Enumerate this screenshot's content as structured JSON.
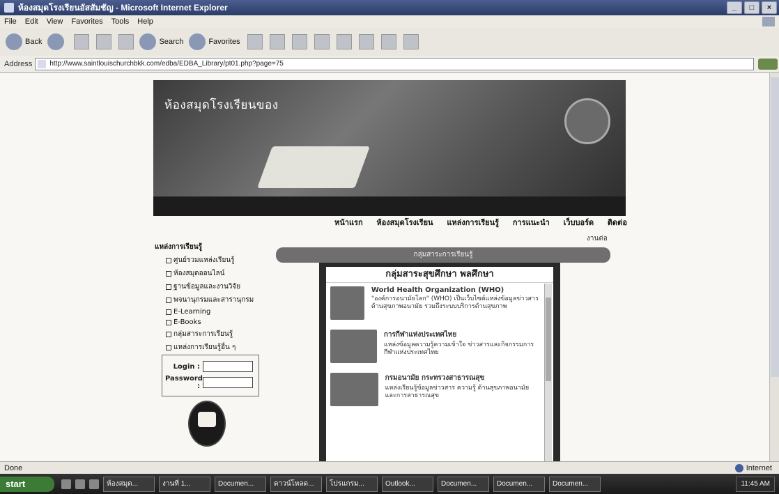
{
  "window": {
    "title": "ห้องสมุดโรงเรียนอัสสัมชัญ - Microsoft Internet Explorer"
  },
  "menu": [
    "File",
    "Edit",
    "View",
    "Favorites",
    "Tools",
    "Help"
  ],
  "toolbar": {
    "back": "Back",
    "search": "Search",
    "favorites": "Favorites"
  },
  "address": {
    "label": "Address",
    "url": "http://www.saintlouischurchbkk.com/edba/EDBA_Library/pt01.php?page=75"
  },
  "banner": {
    "site_title": "ห้องสมุดโรงเรียนของ"
  },
  "nav": [
    "หน้าแรก",
    "ห้องสมุดโรงเรียน",
    "แหล่งการเรียนรู้",
    "การแนะนำ",
    "เว็บบอร์ด",
    "ติดต่อ"
  ],
  "more_link": "งานต่อ",
  "left_menu": {
    "heading": "แหล่งการเรียนรู้",
    "items": [
      "ศูนย์รวมแหล่งเรียนรู้",
      "ห้องสมุดออนไลน์",
      "ฐานข้อมูลและงานวิจัย",
      "พจนานุกรมและสารานุกรม",
      "E-Learning",
      "E-Books",
      "กลุ่มสาระการเรียนรู้",
      "แหล่งการเรียนรู้อื่น ๆ"
    ]
  },
  "login": {
    "login_label": "Login :",
    "password_label": "Password :"
  },
  "scroll_banner": "กลุ่มสาระการเรียนรู้",
  "panel": {
    "title": "กลุ่มสาระสุขศึกษา พลศึกษา",
    "entries": [
      {
        "title": "World Health Organization (WHO)",
        "desc": "\"องค์การอนามัยโลก\" (WHO) เป็นเว็บไซต์แหล่งข้อมูลข่าวสารด้านสุขภาพอนามัย รวมถึงระบบบริการด้านสุขภาพ"
      },
      {
        "title": "การกีฬาแห่งประเทศไทย",
        "desc": "แหล่งข้อมูลความรู้ความเข้าใจ ข่าวสารและกิจกรรมการกีฬาแห่งประเทศไทย"
      },
      {
        "title": "กรมอนามัย กระทรวงสาธารณสุข",
        "desc": "แหล่งเรียนรู้ข้อมูลข่าวสาร ความรู้ ด้านสุขภาพอนามัยและการสาธารณสุข"
      }
    ]
  },
  "status": {
    "left": "Done",
    "zone": "Internet"
  },
  "taskbar": {
    "start": "start",
    "tasks": [
      "ห้องสมุด...",
      "งานที่ 1...",
      "Documen...",
      "ดาวน์โหลด...",
      "โปรแกรม...",
      "Outlook...",
      "Documen...",
      "Documen...",
      "Documen..."
    ],
    "time": "11:45 AM"
  }
}
